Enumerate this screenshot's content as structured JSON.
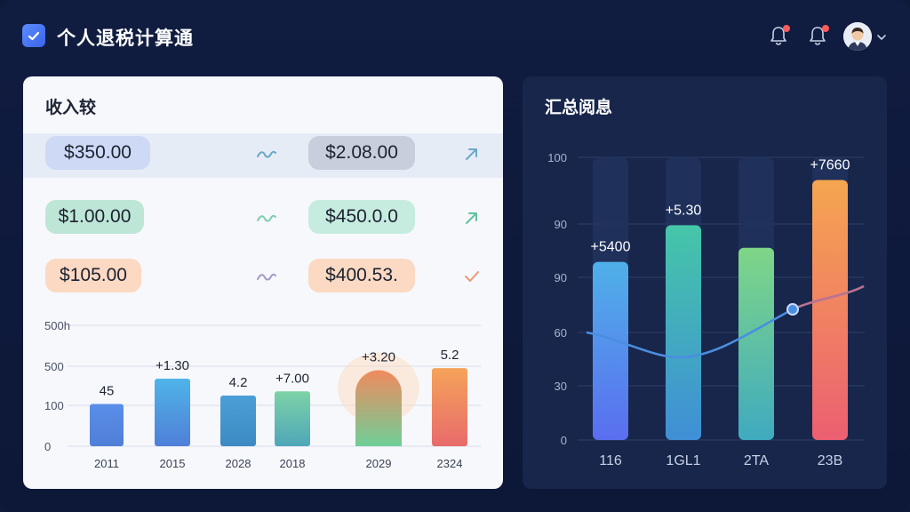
{
  "header": {
    "app_title": "个人退税计算通",
    "icons": [
      "check-logo-icon",
      "bell-icon",
      "bell-icon",
      "avatar",
      "chevron-down-icon"
    ],
    "notification_dot_color": "#ff5c5c"
  },
  "income_panel": {
    "title": "收入较",
    "rows": [
      {
        "left_value": "$350.00",
        "right_value": "$2.08.00",
        "left_color": "#cdd9f5",
        "right_color": "#c8cfdc",
        "trend_icon": "wave-icon",
        "right_icon": "arrow-up-right-icon"
      },
      {
        "left_value": "$1.00.00",
        "right_value": "$450.0.0",
        "left_color": "#bde6d6",
        "right_color": "#c6ecdf",
        "trend_icon": "wave-icon",
        "right_icon": "arrow-up-right-icon"
      },
      {
        "left_value": "$105.00",
        "right_value": "$400.53.",
        "left_color": "#fbd9c3",
        "right_color": "#fbd9c3",
        "trend_icon": "wave-icon",
        "right_icon": "check-icon"
      }
    ]
  },
  "chart_data": [
    {
      "type": "bar",
      "title": "",
      "y_tick_labels": [
        "0",
        "100",
        "500",
        "500h"
      ],
      "categories": [
        "2011",
        "2015",
        "2028",
        "2018",
        "2029",
        "2324"
      ],
      "values": [
        100,
        160,
        120,
        130,
        180,
        185
      ],
      "data_labels": [
        "45",
        "+1.30",
        "4.2",
        "+7.00",
        "+3.20",
        "5.2"
      ],
      "colors": [
        [
          "#5a8ee8",
          "#4f7fd8"
        ],
        [
          "#4fb4e8",
          "#4f7fd8"
        ],
        [
          "#4b9fd6",
          "#3d8ac3"
        ],
        [
          "#7cd3a6",
          "#4fa6b9"
        ],
        [
          "#f08a5d",
          "#6fcf97"
        ],
        [
          "#f5a35a",
          "#e86b6b"
        ]
      ],
      "grid": true
    },
    {
      "type": "bar",
      "title": "汇总阅息",
      "y_tick_labels": [
        "0",
        "30",
        "60",
        "90",
        "90",
        "100"
      ],
      "categories": [
        "116",
        "1GL1",
        "2TA",
        "23B"
      ],
      "values": [
        63,
        76,
        68,
        92
      ],
      "data_labels": [
        "+5400",
        "+5.30",
        "",
        "+7660"
      ],
      "line_values": [
        40,
        30,
        45,
        52
      ],
      "colors": [
        [
          "#4fb0e8",
          "#5a6ef0"
        ],
        [
          "#45c6a8",
          "#3f8fd6"
        ],
        [
          "#7fd687",
          "#3faabf"
        ],
        [
          "#f5a650",
          "#ec5f72"
        ]
      ],
      "grid": true
    }
  ],
  "right_panel": {
    "title": "汇总阅息"
  }
}
